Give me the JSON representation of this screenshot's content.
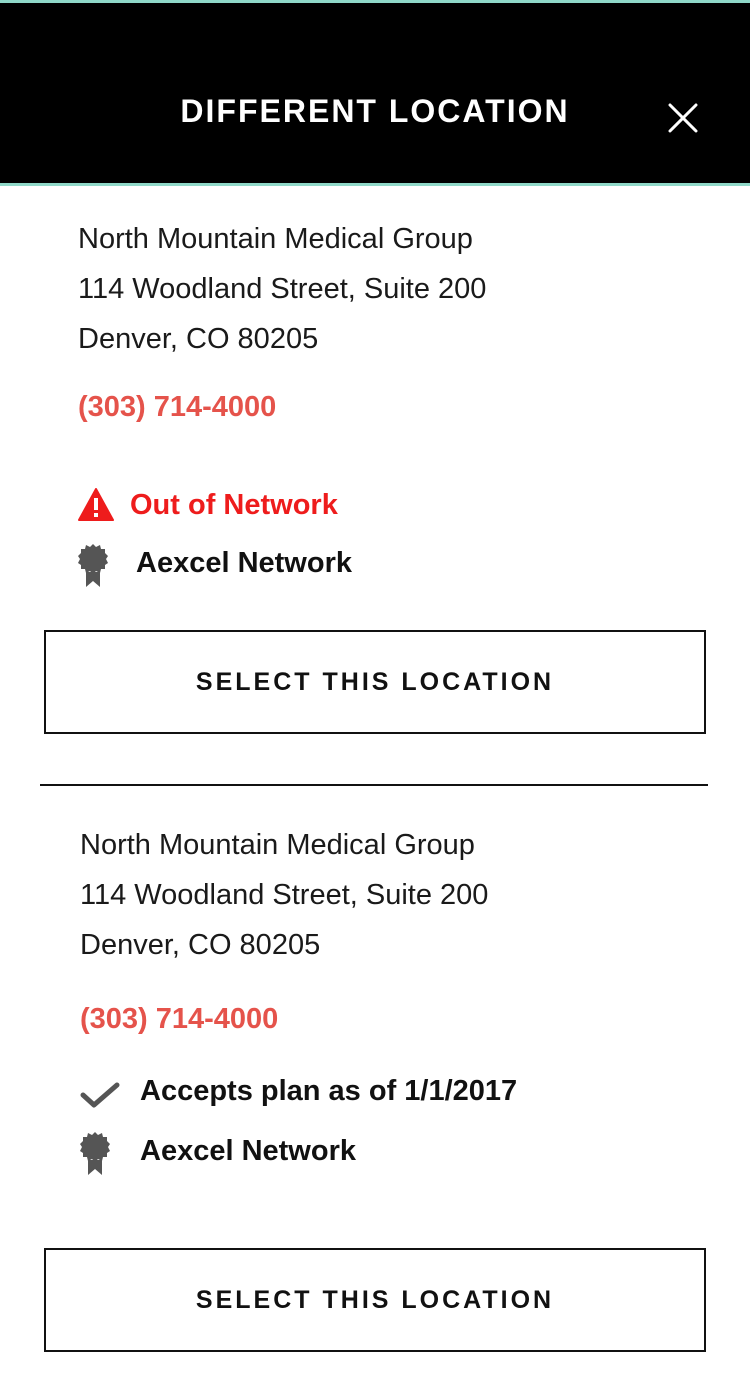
{
  "header": {
    "title": "DIFFERENT LOCATION",
    "close_icon": "close-icon"
  },
  "locations": [
    {
      "name": "North Mountain Medical Group",
      "street": "114 Woodland Street, Suite 200",
      "city_state_zip": "Denver, CO 80205",
      "phone": "(303) 714-4000",
      "network_status": {
        "icon": "warning-icon",
        "text": "Out of Network",
        "color": "#ee1c1c"
      },
      "network": {
        "icon": "award-badge-icon",
        "text": "Aexcel Network"
      },
      "select_label": "SELECT THIS LOCATION"
    },
    {
      "name": "North Mountain Medical Group",
      "street": "114 Woodland Street, Suite 200",
      "city_state_zip": "Denver, CO 80205",
      "phone": "(303) 714-4000",
      "network_status": {
        "icon": "checkmark-icon",
        "text": "Accepts plan as of 1/1/2017",
        "color": "#111111"
      },
      "network": {
        "icon": "award-badge-icon",
        "text": "Aexcel Network"
      },
      "select_label": "SELECT THIS LOCATION"
    }
  ],
  "colors": {
    "header_bg": "#000000",
    "accent": "#8fd8c8",
    "phone": "#e5534b",
    "warning": "#ee1c1c"
  }
}
